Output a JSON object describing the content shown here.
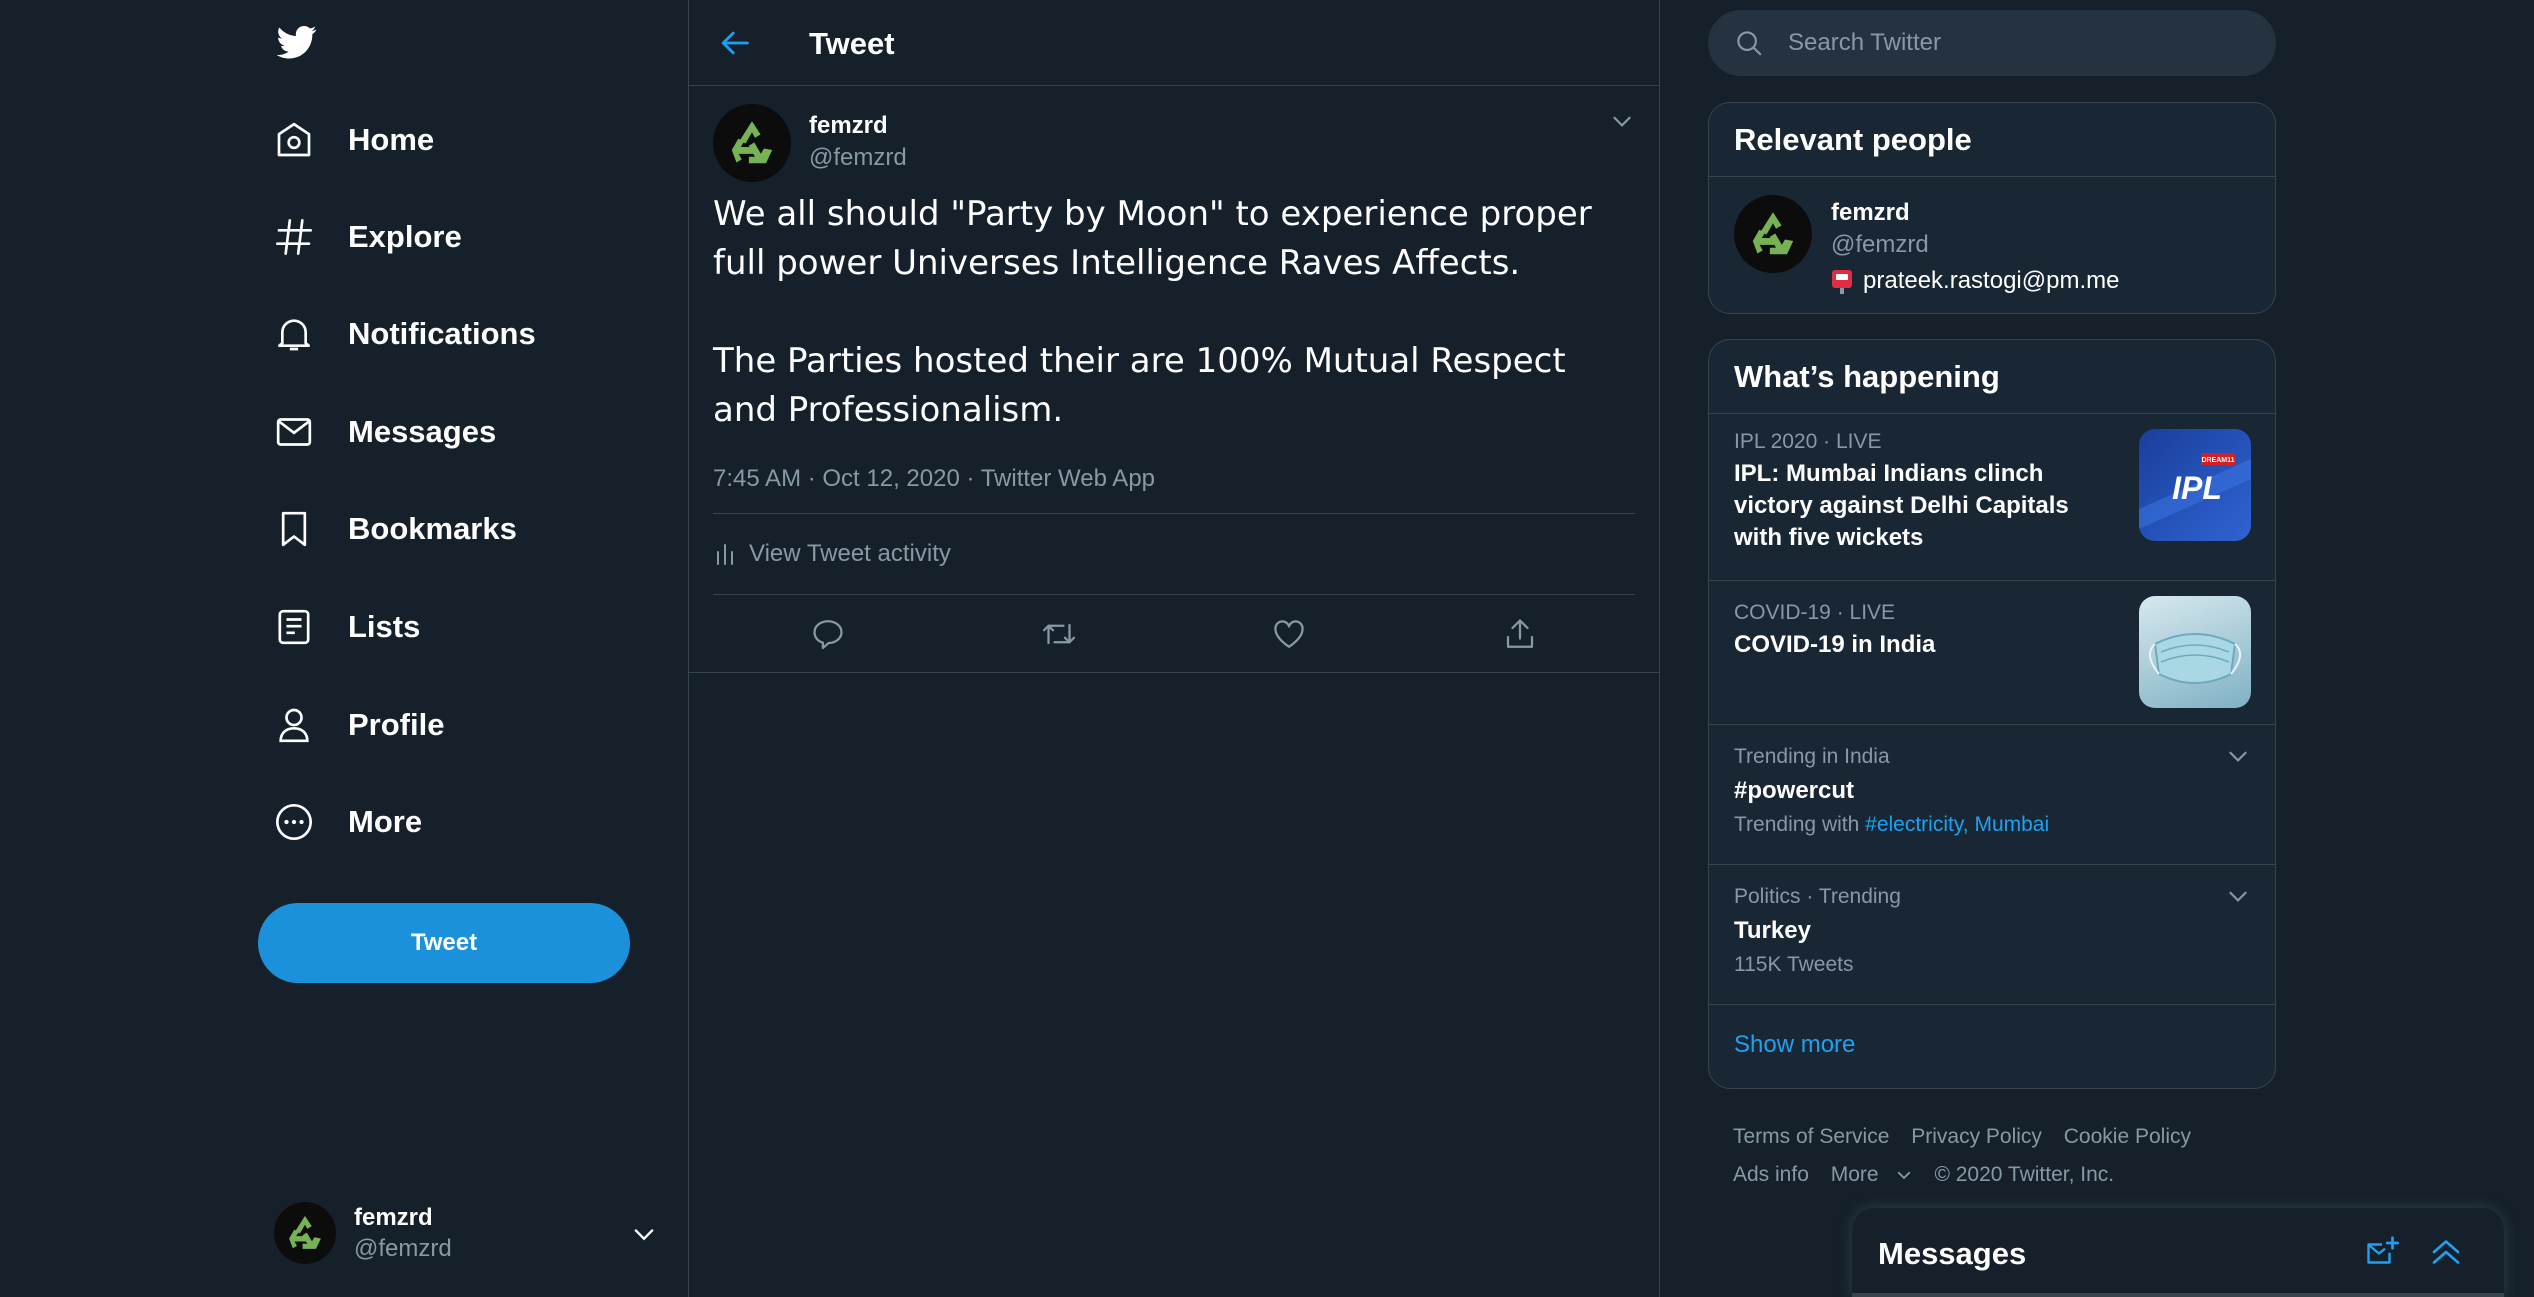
{
  "colors": {
    "background": "#15202b",
    "card": "#192734",
    "border": "#38444d",
    "accent": "#1da1f2",
    "tweet_button": "#1a91da",
    "muted_text": "#8899a6",
    "recycle_green": "#77b255"
  },
  "sidebar": {
    "logo": "twitter-bird-icon",
    "nav": [
      {
        "label": "Home",
        "icon": "home-icon"
      },
      {
        "label": "Explore",
        "icon": "hashtag-icon"
      },
      {
        "label": "Notifications",
        "icon": "bell-icon"
      },
      {
        "label": "Messages",
        "icon": "envelope-icon"
      },
      {
        "label": "Bookmarks",
        "icon": "bookmark-icon"
      },
      {
        "label": "Lists",
        "icon": "list-icon"
      },
      {
        "label": "Profile",
        "icon": "person-icon"
      },
      {
        "label": "More",
        "icon": "more-circle-icon"
      }
    ],
    "tweet_button": "Tweet",
    "account": {
      "name": "femzrd",
      "handle": "@femzrd"
    }
  },
  "main": {
    "header_title": "Tweet",
    "tweet": {
      "author_name": "femzrd",
      "author_handle": "@femzrd",
      "paragraphs": [
        "We all should \"Party by Moon\" to experience proper full power Universes Intelligence Raves Affects.",
        "The Parties hosted their are 100% Mutual Respect and Professionalism."
      ],
      "meta": "7:45 AM · Oct 12, 2020 · Twitter Web App",
      "activity_label": "View Tweet activity",
      "actions": [
        "reply-icon",
        "retweet-icon",
        "like-icon",
        "share-icon"
      ]
    }
  },
  "right": {
    "search_placeholder": "Search Twitter",
    "relevant_people": {
      "title": "Relevant people",
      "person": {
        "name": "femzrd",
        "handle": "@femzrd",
        "bio": "prateek.rastogi@pm.me"
      }
    },
    "happening": {
      "title": "What’s happening",
      "trends": [
        {
          "meta": "IPL 2020 · LIVE",
          "title": "IPL: Mumbai Indians clinch victory against Delhi Capitals with five wickets",
          "thumb_text": "IPL",
          "thumb_badge": "DREAM11"
        },
        {
          "meta": "COVID-19 · LIVE",
          "title": "COVID-19 in India"
        },
        {
          "meta": "Trending in India",
          "title": "#powercut",
          "sub_prefix": "Trending with",
          "sub_links": [
            "#electricity",
            "Mumbai"
          ]
        },
        {
          "meta": "Politics · Trending",
          "title": "Turkey",
          "sub": "115K Tweets"
        }
      ],
      "show_more": "Show more"
    },
    "footer": {
      "links": [
        "Terms of Service",
        "Privacy Policy",
        "Cookie Policy",
        "Ads info",
        "More"
      ],
      "copyright": "© 2020 Twitter, Inc."
    }
  },
  "drawer": {
    "title": "Messages"
  }
}
